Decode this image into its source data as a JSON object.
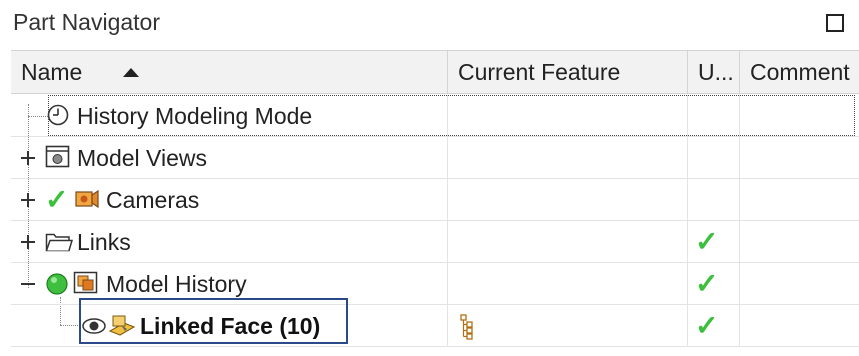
{
  "panel": {
    "title": "Part Navigator"
  },
  "columns": [
    {
      "label": "Name"
    },
    {
      "label": "Current Feature"
    },
    {
      "label": "U..."
    },
    {
      "label": "Comment"
    }
  ],
  "rows": [
    {
      "label": "History Modeling Mode",
      "icon": "clock-icon",
      "expand": "none",
      "status": "none",
      "current_feature": "",
      "u_check": false
    },
    {
      "label": "Model Views",
      "icon": "model-views-icon",
      "expand": "collapsed",
      "status": "none",
      "current_feature": "",
      "u_check": false
    },
    {
      "label": "Cameras",
      "icon": "camera-icon",
      "expand": "collapsed",
      "status": "check",
      "current_feature": "",
      "u_check": false
    },
    {
      "label": "Links",
      "icon": "folder-icon",
      "expand": "collapsed",
      "status": "none",
      "current_feature": "",
      "u_check": true
    },
    {
      "label": "Model History",
      "icon": "model-history-icon",
      "expand": "expanded",
      "status": "green-dot",
      "current_feature": "",
      "u_check": true
    },
    {
      "label": "Linked Face (10)",
      "icon": "linked-face-icon",
      "expand": "none",
      "status": "eye",
      "current_feature": "feature-tree-icon",
      "u_check": true,
      "selected": true
    }
  ],
  "colors": {
    "check": "#3cbf3c",
    "selection": "#2a4a8a"
  }
}
